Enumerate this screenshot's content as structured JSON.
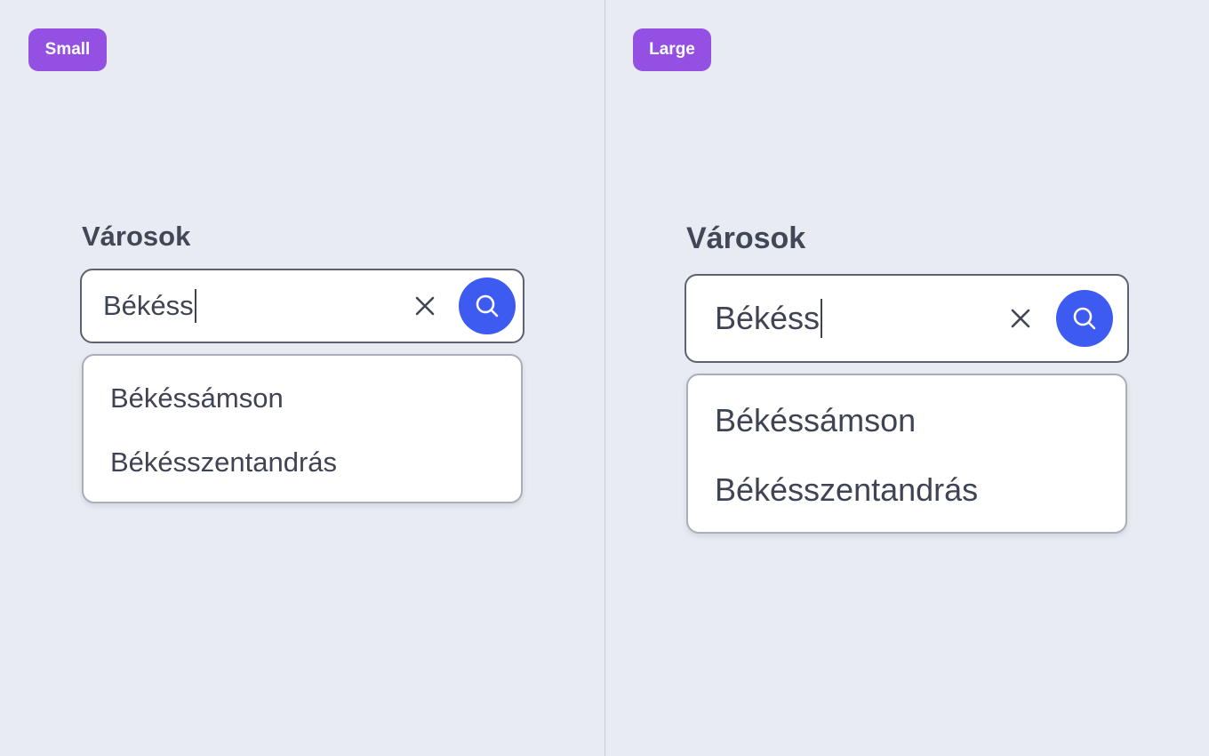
{
  "variants": {
    "small": {
      "badge": "Small",
      "label": "Városok",
      "query": "Békéss",
      "suggestions": [
        "Békéssámson",
        "Békésszentandrás"
      ]
    },
    "large": {
      "badge": "Large",
      "label": "Városok",
      "query": "Békéss",
      "suggestions": [
        "Békéssámson",
        "Békésszentandrás"
      ]
    }
  },
  "icons": {
    "clear": "close-icon",
    "search": "search-icon"
  },
  "colors": {
    "background": "#e8ebf1",
    "badge": "#9450e3",
    "accent": "#3d5bf1",
    "text": "#414756",
    "border": "#5d6272"
  }
}
